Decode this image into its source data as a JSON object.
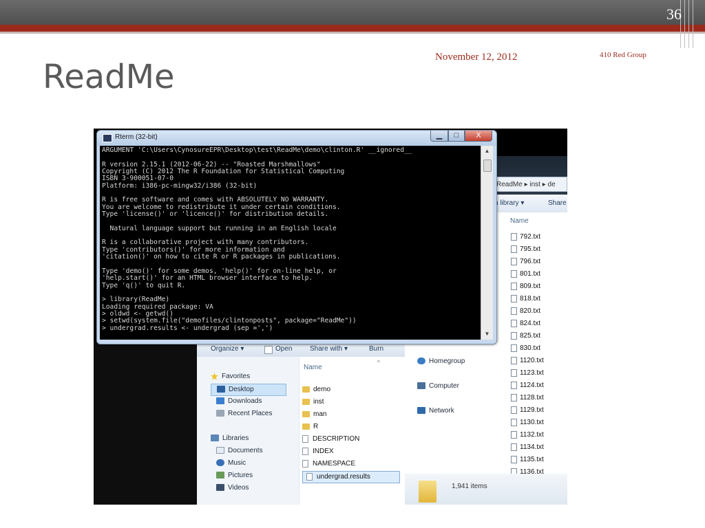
{
  "slide": {
    "number": "36",
    "date": "November 12, 2012",
    "group": "410 Red Group",
    "title": "ReadMe"
  },
  "rterm": {
    "title": "Rterm (32-bit)",
    "min_glyph": "▁",
    "max_glyph": "□",
    "close_glyph": "X",
    "console_lines": [
      "ARGUMENT 'C:\\Users\\CynosureEPR\\Desktop\\test\\ReadMe\\demo\\clinton.R' __ignored__",
      "",
      "R version 2.15.1 (2012-06-22) -- \"Roasted Marshmallows\"",
      "Copyright (C) 2012 The R Foundation for Statistical Computing",
      "ISBN 3-900051-07-0",
      "Platform: i386-pc-mingw32/i386 (32-bit)",
      "",
      "R is free software and comes with ABSOLUTELY NO WARRANTY.",
      "You are welcome to redistribute it under certain conditions.",
      "Type 'license()' or 'licence()' for distribution details.",
      "",
      "  Natural language support but running in an English locale",
      "",
      "R is a collaborative project with many contributors.",
      "Type 'contributors()' for more information and",
      "'citation()' on how to cite R or R packages in publications.",
      "",
      "Type 'demo()' for some demos, 'help()' for on-line help, or",
      "'help.start()' for an HTML browser interface to help.",
      "Type 'q()' to quit R.",
      "",
      "> library(ReadMe)",
      "Loading required package: VA",
      "> oldwd <- getwd()",
      "> setwd(system.file(\"demofiles/clintonposts\", package=\"ReadMe\"))",
      "> undergrad.results <- undergrad (sep =',')"
    ]
  },
  "explorer_back": {
    "breadcrumb": "ReadMe ▸ inst ▸ de",
    "toolbar": {
      "library": "n library ▾",
      "share": "Share"
    },
    "column_name": "Name",
    "nav": [
      {
        "label": "Homegroup",
        "icon": "homegroup-icon"
      },
      {
        "label": "Computer",
        "icon": "computer-icon"
      },
      {
        "label": "Network",
        "icon": "network-icon"
      }
    ],
    "files": [
      "792.txt",
      "795.txt",
      "796.txt",
      "801.txt",
      "809.txt",
      "818.txt",
      "820.txt",
      "824.txt",
      "825.txt",
      "830.txt",
      "1120.txt",
      "1123.txt",
      "1124.txt",
      "1128.txt",
      "1129.txt",
      "1130.txt",
      "1132.txt",
      "1134.txt",
      "1135.txt",
      "1136.txt"
    ],
    "status": "1,941 items"
  },
  "explorer_front": {
    "toolbar": {
      "organize": "Organize ▾",
      "open": "Open",
      "share_with": "Share with ▾",
      "burn": "Burn"
    },
    "column_name": "Name",
    "nav": [
      {
        "label": "Favorites",
        "icon": "star-icon"
      },
      {
        "label": "Desktop",
        "icon": "desktop-icon"
      },
      {
        "label": "Downloads",
        "icon": "downloads-icon"
      },
      {
        "label": "Recent Places",
        "icon": "recent-places-icon"
      },
      {
        "label": "Libraries",
        "icon": "libraries-icon"
      },
      {
        "label": "Documents",
        "icon": "documents-icon"
      },
      {
        "label": "Music",
        "icon": "music-icon"
      },
      {
        "label": "Pictures",
        "icon": "pictures-icon"
      },
      {
        "label": "Videos",
        "icon": "videos-icon"
      }
    ],
    "files": [
      {
        "label": "demo",
        "kind": "folder"
      },
      {
        "label": "inst",
        "kind": "folder"
      },
      {
        "label": "man",
        "kind": "folder"
      },
      {
        "label": "R",
        "kind": "folder"
      },
      {
        "label": "DESCRIPTION",
        "kind": "file"
      },
      {
        "label": "INDEX",
        "kind": "file"
      },
      {
        "label": "NAMESPACE",
        "kind": "file"
      },
      {
        "label": "undergrad.results",
        "kind": "file"
      }
    ]
  },
  "colors": {
    "accent_red": "#9c2a1c",
    "title_gray": "#5a5a5a",
    "selection_blue": "#cde3f7"
  }
}
